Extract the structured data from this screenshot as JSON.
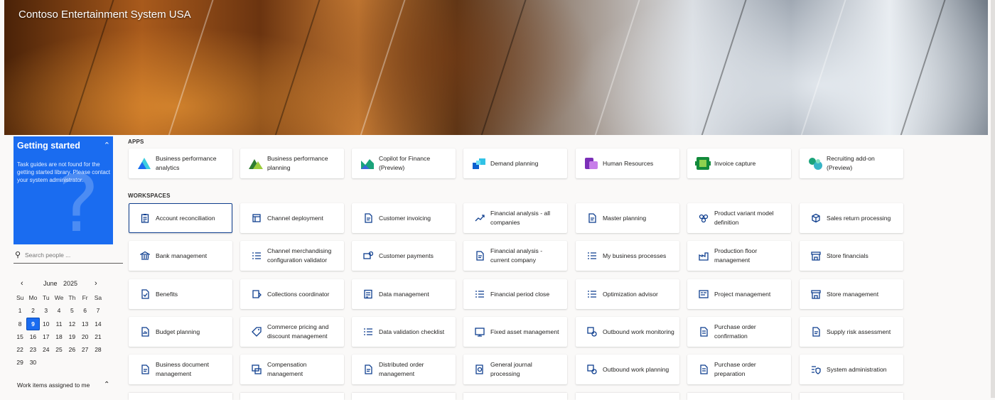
{
  "header": {
    "title": "Contoso Entertainment System USA"
  },
  "getting_started": {
    "title": "Getting started",
    "message": "Task guides are not found for the getting started library. Please contact your system administrator."
  },
  "search": {
    "placeholder": "Search people ..."
  },
  "calendar": {
    "month": "June",
    "year": "2025",
    "weekdays": [
      "Su",
      "Mo",
      "Tu",
      "We",
      "Th",
      "Fr",
      "Sa"
    ],
    "weeks": [
      [
        "1",
        "2",
        "3",
        "4",
        "5",
        "6",
        "7"
      ],
      [
        "8",
        "9",
        "10",
        "11",
        "12",
        "13",
        "14"
      ],
      [
        "15",
        "16",
        "17",
        "18",
        "19",
        "20",
        "21"
      ],
      [
        "22",
        "23",
        "24",
        "25",
        "26",
        "27",
        "28"
      ],
      [
        "29",
        "30",
        "",
        "",
        "",
        "",
        ""
      ]
    ],
    "selected_day": "9"
  },
  "work_items": {
    "title": "Work items assigned to me"
  },
  "apps": {
    "title": "APPS",
    "items": [
      {
        "label": "Business performance analytics",
        "icon": "business-performance-analytics-icon"
      },
      {
        "label": "Business performance planning",
        "icon": "business-performance-planning-icon"
      },
      {
        "label": "Copilot for Finance (Preview)",
        "icon": "copilot-finance-icon"
      },
      {
        "label": "Demand planning",
        "icon": "demand-planning-icon"
      },
      {
        "label": "Human Resources",
        "icon": "human-resources-icon"
      },
      {
        "label": "Invoice capture",
        "icon": "invoice-capture-icon"
      },
      {
        "label": "Recruiting add-on (Preview)",
        "icon": "recruiting-icon"
      }
    ]
  },
  "workspaces": {
    "title": "WORKSPACES",
    "items": [
      {
        "label": "Account reconciliation",
        "icon": "clipboard-icon"
      },
      {
        "label": "Channel deployment",
        "icon": "channel-icon"
      },
      {
        "label": "Customer invoicing",
        "icon": "invoice-icon"
      },
      {
        "label": "Financial analysis - all companies",
        "icon": "trend-icon"
      },
      {
        "label": "Master planning",
        "icon": "planning-doc-icon"
      },
      {
        "label": "Product variant model definition",
        "icon": "variant-icon"
      },
      {
        "label": "Sales return processing",
        "icon": "box-return-icon"
      },
      {
        "label": "Bank management",
        "icon": "bank-icon"
      },
      {
        "label": "Channel merchandising configuration validator",
        "icon": "checklist-icon"
      },
      {
        "label": "Customer payments",
        "icon": "payment-icon"
      },
      {
        "label": "Financial analysis - current company",
        "icon": "chart-doc-icon"
      },
      {
        "label": "My business processes",
        "icon": "process-list-icon"
      },
      {
        "label": "Production floor management",
        "icon": "factory-icon"
      },
      {
        "label": "Store financials",
        "icon": "store-icon"
      },
      {
        "label": "Benefits",
        "icon": "benefits-icon"
      },
      {
        "label": "Collections coordinator",
        "icon": "collections-icon"
      },
      {
        "label": "Data management",
        "icon": "data-icon"
      },
      {
        "label": "Financial period close",
        "icon": "checklist-icon"
      },
      {
        "label": "Optimization advisor",
        "icon": "checklist-icon"
      },
      {
        "label": "Project management",
        "icon": "project-icon"
      },
      {
        "label": "Store management",
        "icon": "store-icon"
      },
      {
        "label": "Budget planning",
        "icon": "budget-icon"
      },
      {
        "label": "Commerce pricing and discount management",
        "icon": "tag-icon"
      },
      {
        "label": "Data validation checklist",
        "icon": "checklist-icon"
      },
      {
        "label": "Fixed asset management",
        "icon": "asset-icon"
      },
      {
        "label": "Outbound work monitoring",
        "icon": "outbound-icon"
      },
      {
        "label": "Purchase order confirmation",
        "icon": "po-icon"
      },
      {
        "label": "Supply risk assessment",
        "icon": "risk-doc-icon"
      },
      {
        "label": "Business document management",
        "icon": "document-icon"
      },
      {
        "label": "Compensation management",
        "icon": "compensation-icon"
      },
      {
        "label": "Distributed order management",
        "icon": "order-doc-icon"
      },
      {
        "label": "General journal processing",
        "icon": "journal-icon"
      },
      {
        "label": "Outbound work planning",
        "icon": "outbound-icon"
      },
      {
        "label": "Purchase order preparation",
        "icon": "po-icon"
      },
      {
        "label": "System administration",
        "icon": "admin-shield-icon"
      }
    ]
  },
  "colors": {
    "accent": "#1a6cf0",
    "tile_icon": "#0f3f8f",
    "background": "#faf9f8"
  }
}
